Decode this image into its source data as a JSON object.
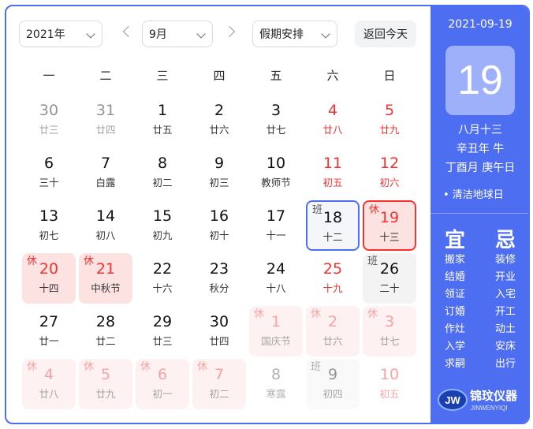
{
  "toolbar": {
    "year": "2021年",
    "month": "9月",
    "holiday_select": "假期安排",
    "today_button": "返回今天"
  },
  "weekdays": [
    "一",
    "二",
    "三",
    "四",
    "五",
    "六",
    "日"
  ],
  "days": [
    {
      "num": "30",
      "lunar": "廿三",
      "state": "other"
    },
    {
      "num": "31",
      "lunar": "廿四",
      "state": "other"
    },
    {
      "num": "1",
      "lunar": "廿五",
      "state": ""
    },
    {
      "num": "2",
      "lunar": "廿六",
      "state": ""
    },
    {
      "num": "3",
      "lunar": "廿七",
      "state": ""
    },
    {
      "num": "4",
      "lunar": "廿八",
      "state": "red"
    },
    {
      "num": "5",
      "lunar": "廿九",
      "state": "red"
    },
    {
      "num": "6",
      "lunar": "三十",
      "state": ""
    },
    {
      "num": "7",
      "lunar": "白露",
      "state": ""
    },
    {
      "num": "8",
      "lunar": "初二",
      "state": ""
    },
    {
      "num": "9",
      "lunar": "初三",
      "state": ""
    },
    {
      "num": "10",
      "lunar": "教师节",
      "state": ""
    },
    {
      "num": "11",
      "lunar": "初五",
      "state": "red"
    },
    {
      "num": "12",
      "lunar": "初六",
      "state": "red"
    },
    {
      "num": "13",
      "lunar": "初七",
      "state": ""
    },
    {
      "num": "14",
      "lunar": "初八",
      "state": ""
    },
    {
      "num": "15",
      "lunar": "初九",
      "state": ""
    },
    {
      "num": "16",
      "lunar": "初十",
      "state": ""
    },
    {
      "num": "17",
      "lunar": "十一",
      "state": ""
    },
    {
      "num": "18",
      "lunar": "十二",
      "state": "work today",
      "mark": "班"
    },
    {
      "num": "19",
      "lunar": "十三",
      "state": "holiday selected",
      "mark": "休"
    },
    {
      "num": "20",
      "lunar": "十四",
      "state": "holiday",
      "mark": "休"
    },
    {
      "num": "21",
      "lunar": "中秋节",
      "state": "holiday",
      "mark": "休"
    },
    {
      "num": "22",
      "lunar": "十六",
      "state": ""
    },
    {
      "num": "23",
      "lunar": "秋分",
      "state": ""
    },
    {
      "num": "24",
      "lunar": "十八",
      "state": ""
    },
    {
      "num": "25",
      "lunar": "十九",
      "state": "red"
    },
    {
      "num": "26",
      "lunar": "二十",
      "state": "work",
      "mark": "班"
    },
    {
      "num": "27",
      "lunar": "廿一",
      "state": ""
    },
    {
      "num": "28",
      "lunar": "廿二",
      "state": ""
    },
    {
      "num": "29",
      "lunar": "廿三",
      "state": ""
    },
    {
      "num": "30",
      "lunar": "廿四",
      "state": ""
    },
    {
      "num": "1",
      "lunar": "国庆节",
      "state": "other holiday",
      "mark": "休"
    },
    {
      "num": "2",
      "lunar": "廿六",
      "state": "other holiday",
      "mark": "休"
    },
    {
      "num": "3",
      "lunar": "廿七",
      "state": "other holiday",
      "mark": "休"
    },
    {
      "num": "4",
      "lunar": "廿八",
      "state": "other holiday",
      "mark": "休"
    },
    {
      "num": "5",
      "lunar": "廿九",
      "state": "other holiday",
      "mark": "休"
    },
    {
      "num": "6",
      "lunar": "初一",
      "state": "other holiday",
      "mark": "休"
    },
    {
      "num": "7",
      "lunar": "初二",
      "state": "other holiday",
      "mark": "休"
    },
    {
      "num": "8",
      "lunar": "寒露",
      "state": "other plain"
    },
    {
      "num": "9",
      "lunar": "初四",
      "state": "other work",
      "mark": "班"
    },
    {
      "num": "10",
      "lunar": "初五",
      "state": "other red"
    }
  ],
  "detail": {
    "date": "2021-09-19",
    "day": "19",
    "lunar_date": "八月十三",
    "year_ganzhi": "辛丑年 牛",
    "month_day_ganzhi": "丁酉月 庚午日",
    "festival": "• 清洁地球日",
    "yi_title": "宜",
    "ji_title": "忌",
    "yi": [
      "搬家",
      "结婚",
      "领证",
      "订婚",
      "作灶",
      "入学",
      "求嗣"
    ],
    "ji": [
      "装修",
      "开业",
      "入宅",
      "开工",
      "动土",
      "安床",
      "出行"
    ]
  },
  "logo": {
    "text": "锦玟仪器",
    "sub": "JINWENYIQI",
    "mark": "JW"
  },
  "colors": {
    "accent": "#4e6ef2",
    "holiday_red": "#f73131",
    "holiday_bg": "#fde2e2",
    "work_bg": "#f3f3f3"
  }
}
